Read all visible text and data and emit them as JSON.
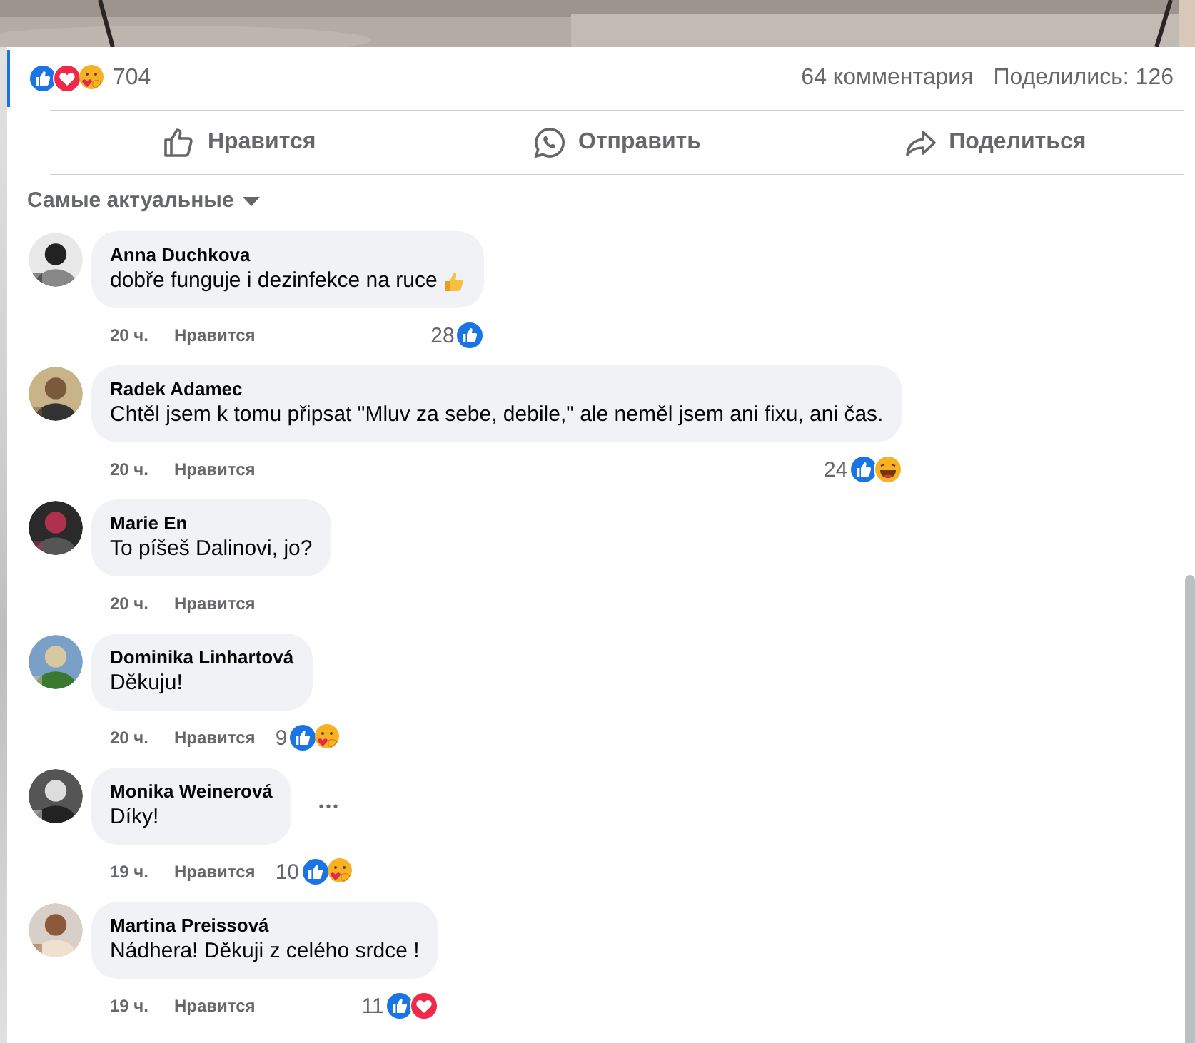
{
  "summary": {
    "reactions": [
      {
        "kind": "like"
      },
      {
        "kind": "love"
      },
      {
        "kind": "care"
      }
    ],
    "count": "704",
    "comments": "64 комментария",
    "shares": "Поделились: 126"
  },
  "actions": [
    {
      "kind": "like",
      "label": "Нравится"
    },
    {
      "kind": "send",
      "label": "Отправить"
    },
    {
      "kind": "share",
      "label": "Поделиться"
    }
  ],
  "sort": {
    "label": "Самые актуальные"
  },
  "comments": [
    {
      "author": "Anna Duchkova",
      "text": "dobře funguje i dezinfekce na ruce",
      "emoji": true,
      "time": "20 ч.",
      "like": "Нравится",
      "reaction_count": "28",
      "reactions": [
        {
          "kind": "like"
        }
      ],
      "more": false
    },
    {
      "author": "Radek Adamec",
      "text": "Chtěl jsem k tomu připsat \"Mluv za sebe, debile,\" ale neměl jsem ani fixu, ani čas.",
      "emoji": false,
      "time": "20 ч.",
      "like": "Нравится",
      "reaction_count": "24",
      "reactions": [
        {
          "kind": "like"
        },
        {
          "kind": "haha"
        }
      ],
      "more": false
    },
    {
      "author": "Marie En",
      "text": "To píšeš Dalinovi, jo?",
      "emoji": false,
      "time": "20 ч.",
      "like": "Нравится",
      "more": false
    },
    {
      "author": "Dominika Linhartová",
      "text": "Děkuju!",
      "emoji": false,
      "time": "20 ч.",
      "like": "Нравится",
      "reaction_count": "9",
      "reactions": [
        {
          "kind": "like"
        },
        {
          "kind": "care"
        }
      ],
      "more": false
    },
    {
      "author": "Monika Weinerová",
      "text": "Díky!",
      "emoji": false,
      "time": "19 ч.",
      "like": "Нравится",
      "reaction_count": "10",
      "reactions": [
        {
          "kind": "like"
        },
        {
          "kind": "care"
        }
      ],
      "more": true
    },
    {
      "author": "Martina Preissová",
      "text": "Nádhera! Děkuji z celého srdce !",
      "emoji": false,
      "time": "19 ч.",
      "like": "Нравится",
      "reaction_count": "11",
      "reactions": [
        {
          "kind": "like"
        },
        {
          "kind": "love"
        }
      ],
      "more": false
    }
  ]
}
